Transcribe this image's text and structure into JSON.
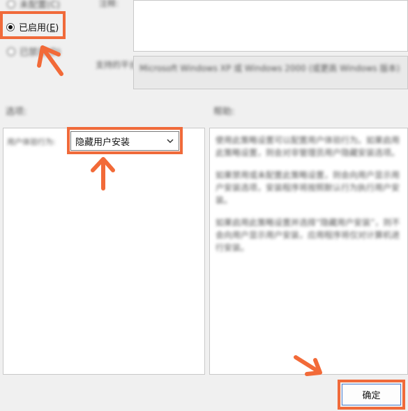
{
  "options": {
    "not_configured": "未配置(C)",
    "enabled_label": "已启用(",
    "enabled_hotkey": "E",
    "enabled_suffix": ")",
    "disabled": "已禁用(D)"
  },
  "comment": {
    "label": "注释:"
  },
  "supported": {
    "label": "支持的平台:",
    "value": "Microsoft Windows XP 或 Windows 2000 (或更高 Windows 版本)"
  },
  "sections": {
    "options_label": "选项:",
    "help_label": "帮助:"
  },
  "option_field": {
    "label": "用户体验行为:",
    "selected": "隐藏用户安装"
  },
  "help_text": [
    "使用此策略设置可以配置用户体验行为。如果启用此策略设置，则会对非管理员用户隐藏安装选项。",
    "如果禁用或未配置此策略设置，则会向用户显示用户安装选项，安装程序将按照默认行为执行用户安装。",
    "如果启用此策略设置并选择“隐藏用户安装”，则不会向用户显示用户安装，应用程序将仅对计算机进行安装。"
  ],
  "buttons": {
    "ok": "确定"
  },
  "colors": {
    "highlight": "#f06a3a",
    "arrow": "#f26a38"
  }
}
